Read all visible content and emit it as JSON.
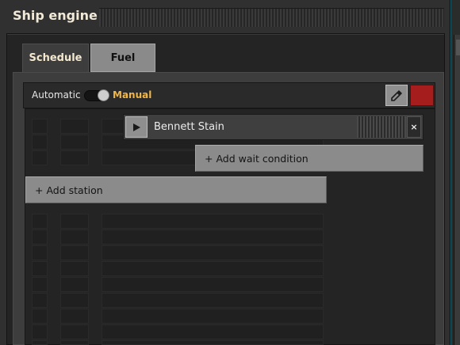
{
  "window": {
    "title": "Ship engine"
  },
  "tabs": [
    {
      "label": "Schedule",
      "active": true
    },
    {
      "label": "Fuel",
      "active": false
    }
  ],
  "toolbar": {
    "automatic_label": "Automatic",
    "manual_label": "Manual",
    "mode": "Manual",
    "color_swatch": "#a61d1d",
    "picker_icon": "eyedropper-icon"
  },
  "schedule": {
    "station": {
      "name": "Bennett Stain",
      "play_icon": "play-icon",
      "close_label": "×"
    },
    "add_wait_label": "+ Add wait condition",
    "add_station_label": "+ Add station"
  }
}
